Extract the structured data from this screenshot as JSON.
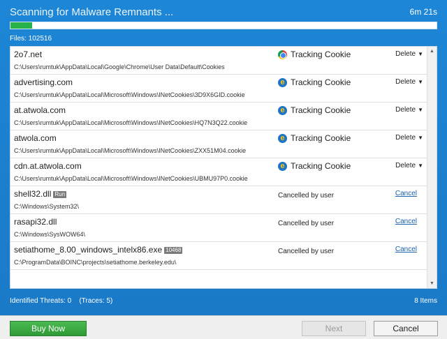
{
  "header": {
    "title": "Scanning for Malware Remnants ...",
    "timer": "6m 21s",
    "progress_fraction": 0.05,
    "progress_color": "#27b24a"
  },
  "files_label": "Files: 102516",
  "rows": [
    {
      "name": "2o7.net",
      "path": "C:\\Users\\rumtuk\\AppData\\Local\\Google\\Chrome\\User Data\\Default\\Cookies",
      "icon": "chrome-icon",
      "threat": "Tracking Cookie",
      "action": "Delete"
    },
    {
      "name": "advertising.com",
      "path": "C:\\Users\\rumtuk\\AppData\\Local\\Microsoft\\Windows\\INetCookies\\3D9X6GID.cookie",
      "icon": "internet-explorer-icon",
      "threat": "Tracking Cookie",
      "action": "Delete"
    },
    {
      "name": "at.atwola.com",
      "path": "C:\\Users\\rumtuk\\AppData\\Local\\Microsoft\\Windows\\INetCookies\\HQ7N3Q22.cookie",
      "icon": "internet-explorer-icon",
      "threat": "Tracking Cookie",
      "action": "Delete"
    },
    {
      "name": "atwola.com",
      "path": "C:\\Users\\rumtuk\\AppData\\Local\\Microsoft\\Windows\\INetCookies\\ZXX51M04.cookie",
      "icon": "internet-explorer-icon",
      "threat": "Tracking Cookie",
      "action": "Delete"
    },
    {
      "name": "cdn.at.atwola.com",
      "path": "C:\\Users\\rumtuk\\AppData\\Local\\Microsoft\\Windows\\INetCookies\\UBMU97P0.cookie",
      "icon": "internet-explorer-icon",
      "threat": "Tracking Cookie",
      "action": "Delete"
    },
    {
      "name": "shell32.dll",
      "tag": "Run",
      "path": "C:\\Windows\\System32\\",
      "status": "Cancelled by user",
      "link": "Cancel"
    },
    {
      "name": "rasapi32.dll",
      "path": "C:\\Windows\\SysWOW64\\",
      "status": "Cancelled by user",
      "link": "Cancel"
    },
    {
      "name": "setiathome_8.00_windows_intelx86.exe",
      "tag": "10468",
      "path": "C:\\ProgramData\\BOINC\\projects\\setiathome.berkeley.edu\\",
      "status": "Cancelled by user",
      "link": "Cancel"
    }
  ],
  "footer": {
    "threats_label": "Identified Threats: 0",
    "traces_label": "(Traces: 5)",
    "items_label": "8 Items"
  },
  "buttons": {
    "buy_now": "Buy Now",
    "next": "Next",
    "cancel": "Cancel"
  }
}
